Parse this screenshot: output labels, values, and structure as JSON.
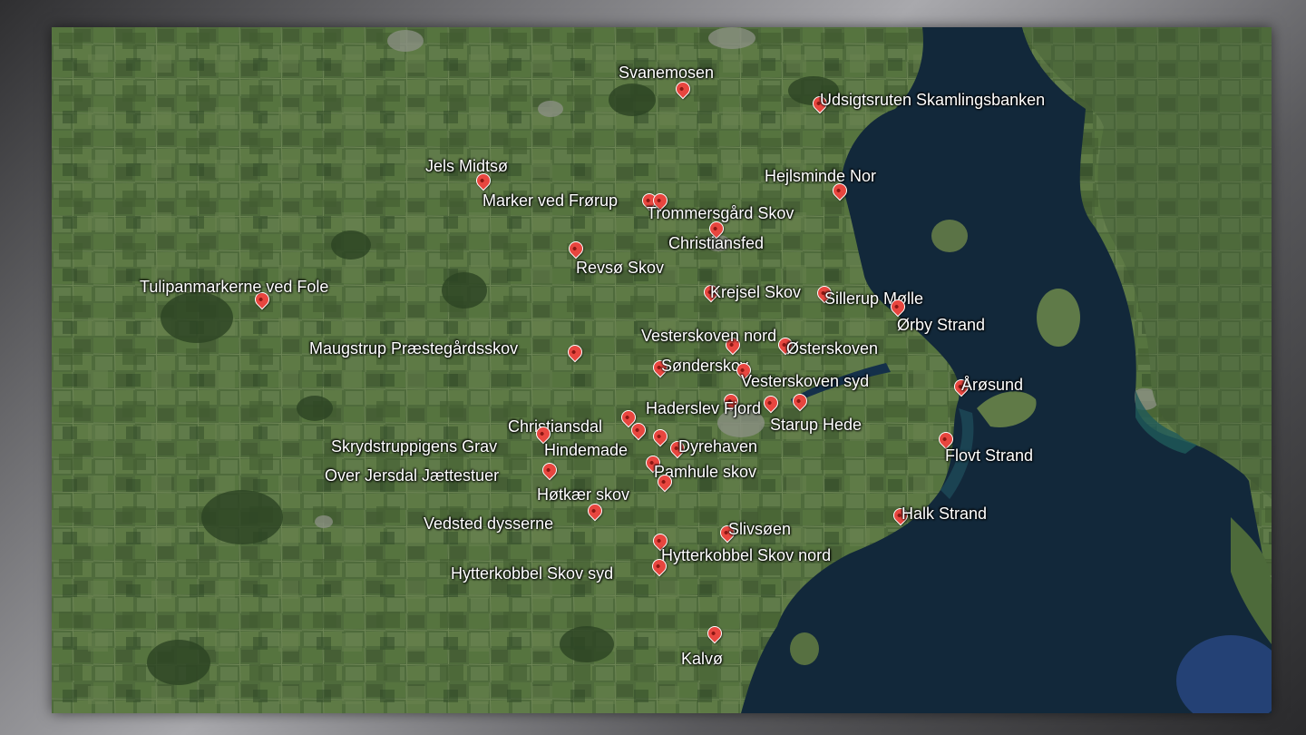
{
  "map": {
    "colors": {
      "land": "#4f6b3c",
      "land_dark": "#2f4a27",
      "water": "#12283a",
      "water_shallow": "#1e4a58",
      "pin": "#e8463f",
      "label": "#ffffff"
    },
    "places": [
      {
        "id": "svanemosen",
        "label": "Svanemosen"
      },
      {
        "id": "udsigtsruten",
        "label": "Udsigtsruten Skamlingsbanken"
      },
      {
        "id": "jels-midtso",
        "label": "Jels Midtsø"
      },
      {
        "id": "hejlsminde-nor",
        "label": "Hejlsminde Nor"
      },
      {
        "id": "marker-ved-frorup",
        "label": "Marker ved Frørup"
      },
      {
        "id": "trommersgard-skov",
        "label": "Trommersgård Skov"
      },
      {
        "id": "christiansfed",
        "label": "Christiansfed"
      },
      {
        "id": "revso-skov",
        "label": "Revsø Skov"
      },
      {
        "id": "tulipanmarkerne",
        "label": "Tulipanmarkerne ved Fole"
      },
      {
        "id": "krejsel-skov",
        "label": "Krejsel Skov"
      },
      {
        "id": "sillerup-molle",
        "label": "Sillerup Mølle"
      },
      {
        "id": "orby-strand",
        "label": "Ørby Strand"
      },
      {
        "id": "vesterskoven-nord",
        "label": "Vesterskoven nord"
      },
      {
        "id": "maugstrup",
        "label": "Maugstrup Præstegårdsskov"
      },
      {
        "id": "osterskoven",
        "label": "Østerskoven"
      },
      {
        "id": "sonderskov",
        "label": "Sønderskov"
      },
      {
        "id": "vesterskoven-syd",
        "label": "Vesterskoven syd"
      },
      {
        "id": "arosund",
        "label": "Årøsund"
      },
      {
        "id": "haderslev-fjord",
        "label": "Haderslev Fjord"
      },
      {
        "id": "starup-hede",
        "label": "Starup Hede"
      },
      {
        "id": "christiansdal",
        "label": "Christiansdal"
      },
      {
        "id": "skrydstruppigens-grav",
        "label": "Skrydstruppigens Grav"
      },
      {
        "id": "hindemade",
        "label": "Hindemade"
      },
      {
        "id": "dyrehaven",
        "label": "Dyrehaven"
      },
      {
        "id": "flovt-strand",
        "label": "Flovt Strand"
      },
      {
        "id": "over-jersdal",
        "label": "Over Jersdal Jættestuer"
      },
      {
        "id": "pamhule-skov",
        "label": "Pamhule skov"
      },
      {
        "id": "hotkaer-skov",
        "label": "Høtkær skov"
      },
      {
        "id": "vedsted-dysserne",
        "label": "Vedsted dysserne"
      },
      {
        "id": "halk-strand",
        "label": "Halk Strand"
      },
      {
        "id": "slivsoen",
        "label": "Slivsøen"
      },
      {
        "id": "hytterkobbel-nord",
        "label": "Hytterkobbel Skov nord"
      },
      {
        "id": "hytterkobbel-syd",
        "label": "Hytterkobbel Skov syd"
      },
      {
        "id": "kalvo",
        "label": "Kalvø"
      }
    ]
  }
}
